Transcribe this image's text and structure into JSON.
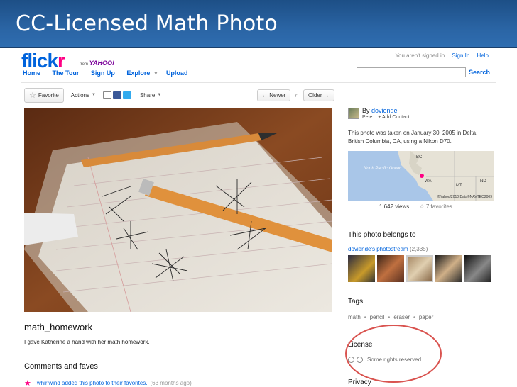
{
  "slide": {
    "title": "CC-Licensed Math Photo"
  },
  "header": {
    "logo_part1": "flick",
    "logo_part2": "r",
    "logo_from": "from",
    "logo_yahoo": "YAHOO!",
    "signed_in_text": "You aren't signed in",
    "sign_in": "Sign In",
    "help": "Help",
    "search_button": "Search",
    "search_value": ""
  },
  "nav": {
    "home": "Home",
    "tour": "The Tour",
    "signup": "Sign Up",
    "explore": "Explore",
    "upload": "Upload"
  },
  "toolbar": {
    "favorite": "Favorite",
    "actions": "Actions",
    "share": "Share",
    "newer": "← Newer",
    "older": "Older →"
  },
  "photo": {
    "title": "math_homework",
    "description": "I gave Katherine a hand with her math homework."
  },
  "comments": {
    "heading": "Comments and faves",
    "entry_text": "whirlwind added this photo to their favorites.",
    "entry_ago": "(63 months ago)"
  },
  "sidebar": {
    "by": "By",
    "author": "doviende",
    "author_sub": "Pete",
    "add_contact": "+ Add Contact",
    "taken": "This photo was taken on January 30, 2005 in Delta, British Columbia, CA, using a Nikon D70.",
    "map": {
      "ocean": "North Pacific Ocean",
      "labels": [
        "BC",
        "WA",
        "MT",
        "ND"
      ],
      "credit": "©Yahoo!2010,Data©NAVTEQ2009"
    },
    "views": "1,642 views",
    "favorites": "☆ 7 favorites",
    "belongs_heading": "This photo belongs to",
    "stream": "doviende's photostream",
    "stream_count": "(2,335)",
    "tags_heading": "Tags",
    "tags": [
      "math",
      "pencil",
      "eraser",
      "paper"
    ],
    "license_heading": "License",
    "license_text": "Some rights reserved",
    "privacy_heading": "Privacy"
  },
  "colors": {
    "flickr_blue": "#0063dc",
    "flickr_pink": "#ff0084",
    "slide_blue": "#2a64a4",
    "annotation_red": "#d9534f"
  }
}
